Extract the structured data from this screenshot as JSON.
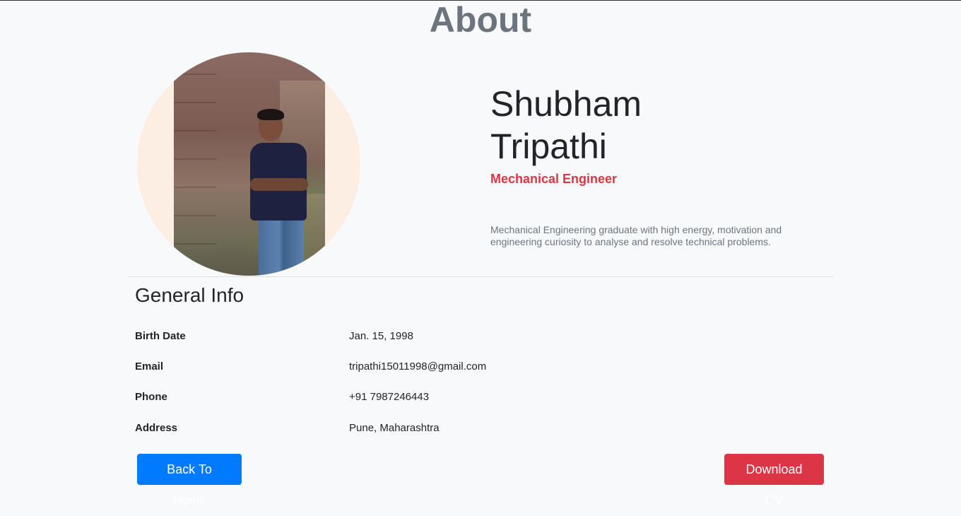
{
  "page": {
    "title": "About"
  },
  "profile": {
    "name": "Shubham Tripathi",
    "role": "Mechanical Engineer",
    "bio": "Mechanical Engineering graduate with high energy, motivation and engineering curiosity to analyse and resolve technical problems."
  },
  "general_info": {
    "title": "General Info",
    "rows": [
      {
        "label": "Birth Date",
        "value": "Jan. 15, 1998"
      },
      {
        "label": "Email",
        "value": "tripathi15011998@gmail.com"
      },
      {
        "label": "Phone",
        "value": "+91 7987246443"
      },
      {
        "label": "Address",
        "value": "Pune, Maharashtra"
      }
    ]
  },
  "actions": {
    "home_label": "Back To Home",
    "cv_label": "Download CV"
  },
  "colors": {
    "primary": "#007bff",
    "danger": "#dc3545",
    "muted": "#6c757d",
    "avatar_bg": "#fdeee4"
  }
}
